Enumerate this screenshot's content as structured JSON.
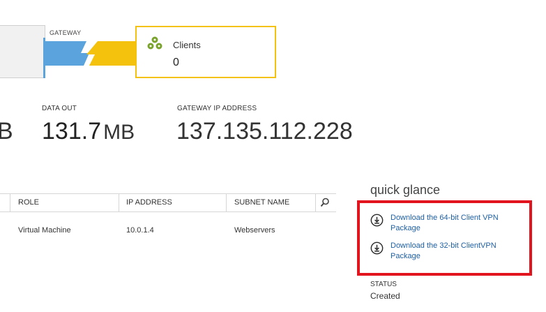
{
  "diagram": {
    "gateway_label": "GATEWAY",
    "clients_title": "Clients",
    "clients_count": "0",
    "colors": {
      "vnet": "#5ba3dc",
      "clients": "#f4c20d",
      "icon": "#7aa32b"
    }
  },
  "stats": {
    "data_in_partial": "B",
    "data_out_label": "DATA OUT",
    "data_out_value": "131.7",
    "data_out_unit": "MB",
    "gateway_ip_label": "GATEWAY IP ADDRESS",
    "gateway_ip_value": "137.135.112.228"
  },
  "table": {
    "headers": {
      "role": "ROLE",
      "ip": "IP ADDRESS",
      "subnet": "SUBNET NAME"
    },
    "rows": [
      {
        "role": "Virtual Machine",
        "ip": "10.0.1.4",
        "subnet": "Webservers"
      }
    ]
  },
  "quick_glance": {
    "title": "quick glance",
    "links": [
      {
        "label": "Download the 64-bit Client VPN Package"
      },
      {
        "label": "Download the 32-bit ClientVPN Package"
      }
    ],
    "status_label": "STATUS",
    "status_value": "Created",
    "colors": {
      "link": "#1e5fa4",
      "highlight": "#e2141e"
    }
  }
}
